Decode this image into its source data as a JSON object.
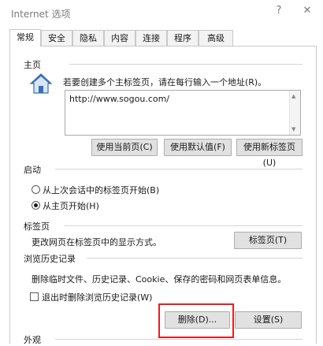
{
  "window": {
    "title": "Internet 选项",
    "help_glyph": "?",
    "close_glyph": "✕"
  },
  "tabs": [
    "常规",
    "安全",
    "隐私",
    "内容",
    "连接",
    "程序",
    "高级"
  ],
  "home": {
    "section_label": "主页",
    "description": "若要创建多个主标签页，请在每行输入一个地址(R)。",
    "url": "http://www.sogou.com/",
    "buttons": {
      "use_current": "使用当前页(C)",
      "use_default": "使用默认值(F)",
      "use_new_tab": "使用新标签页(U)"
    }
  },
  "startup": {
    "section_label": "启动",
    "option_last_session": "从上次会话中的标签页开始(B)",
    "option_home": "从主页开始(H)",
    "selected": "option_home"
  },
  "tabs_section": {
    "section_label": "标签页",
    "description": "更改网页在标签页中的显示方式。",
    "button": "标签页(T)"
  },
  "history": {
    "section_label": "浏览历史记录",
    "description": "删除临时文件、历史记录、Cookie、保存的密码和网页表单信息。",
    "checkbox_label": "退出时删除浏览历史记录(W)",
    "checkbox_checked": false,
    "delete_button": "删除(D)...",
    "settings_button": "设置(S)"
  },
  "appearance": {
    "section_label": "外观"
  },
  "colors": {
    "highlight": "#e02020",
    "icon_roof": "#3b6fb6",
    "icon_wall": "#d9e6f5"
  }
}
